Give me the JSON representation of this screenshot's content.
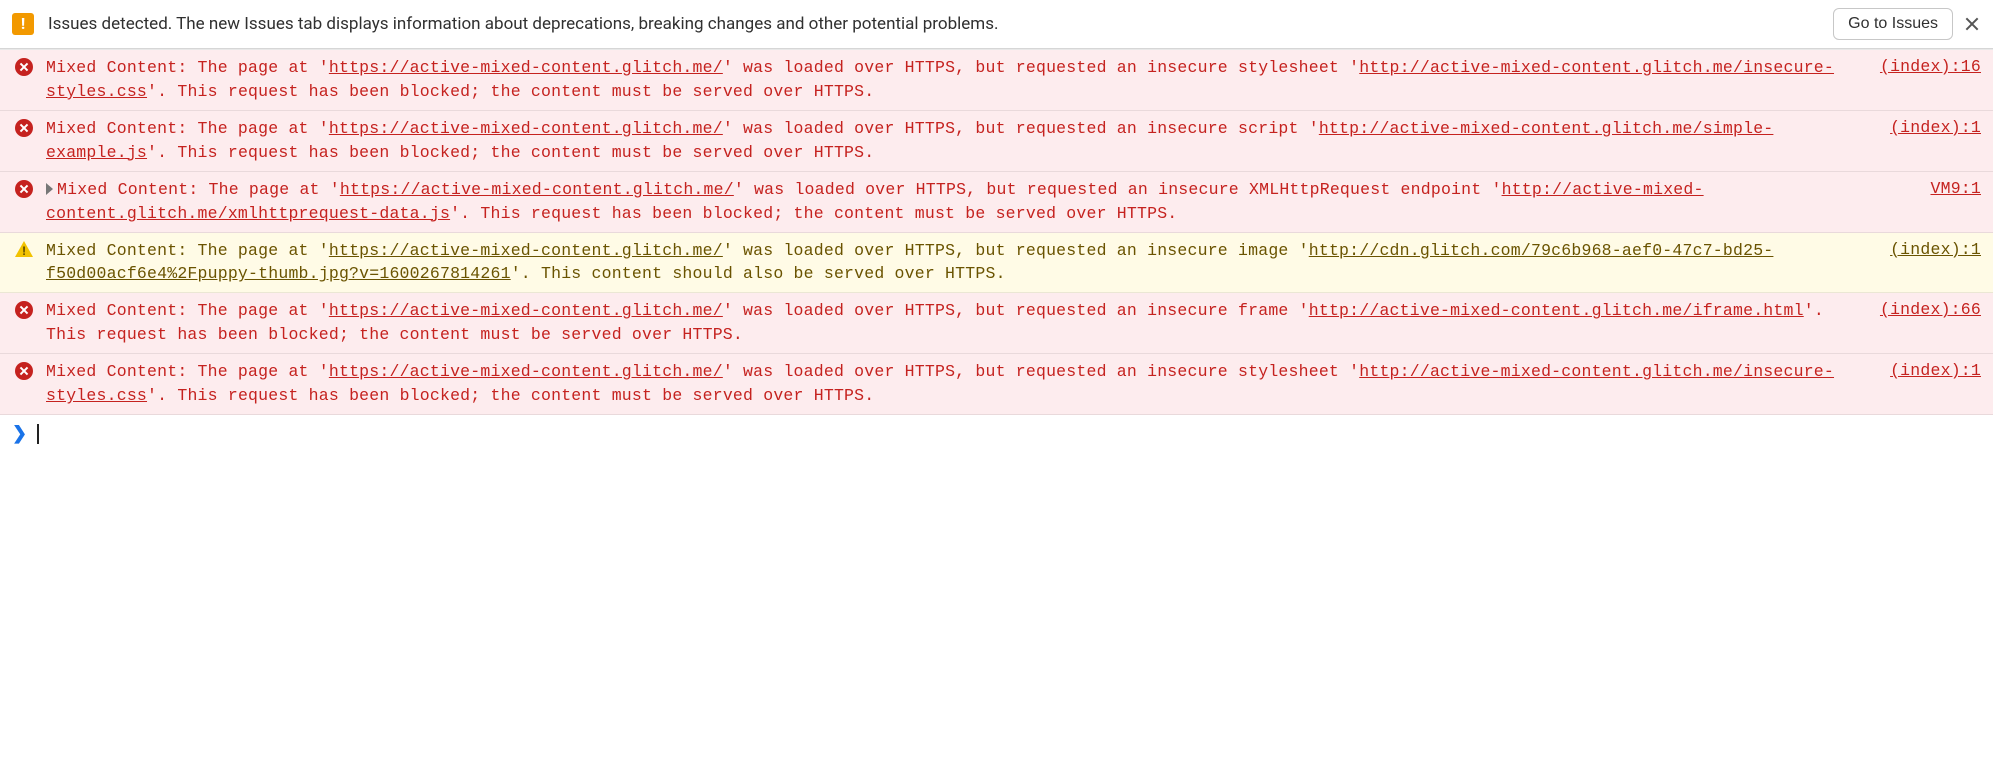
{
  "issues_bar": {
    "text": "Issues detected. The new Issues tab displays information about deprecations, breaking changes and other potential problems.",
    "button_label": "Go to Issues"
  },
  "messages": [
    {
      "level": "error",
      "expandable": false,
      "prefix": "Mixed Content: The page at '",
      "page_url": "https://active-mixed-content.glitch.me/",
      "mid1": "' was loaded over HTTPS, but requested an insecure stylesheet '",
      "resource_url": "http://active-mixed-content.glitch.me/insecure-styles.css",
      "suffix": "'. This request has been blocked; the content must be served over HTTPS.",
      "source": "(index):16"
    },
    {
      "level": "error",
      "expandable": false,
      "prefix": "Mixed Content: The page at '",
      "page_url": "https://active-mixed-content.glitch.me/",
      "mid1": "' was loaded over HTTPS, but requested an insecure script '",
      "resource_url": "http://active-mixed-content.glitch.me/simple-example.js",
      "suffix": "'. This request has been blocked; the content must be served over HTTPS.",
      "source": "(index):1"
    },
    {
      "level": "error",
      "expandable": true,
      "prefix": "Mixed Content: The page at '",
      "page_url": "https://active-mixed-content.glitch.me/",
      "mid1": "' was loaded over HTTPS, but requested an insecure XMLHttpRequest endpoint '",
      "resource_url": "http://active-mixed-content.glitch.me/xmlhttprequest-data.js",
      "suffix": "'. This request has been blocked; the content must be served over HTTPS.",
      "source": "VM9:1"
    },
    {
      "level": "warn",
      "expandable": false,
      "prefix": "Mixed Content: The page at '",
      "page_url": "https://active-mixed-content.glitch.me/",
      "mid1": "' was loaded over HTTPS, but requested an insecure image '",
      "resource_url": "http://cdn.glitch.com/79c6b968-aef0-47c7-bd25-f50d00acf6e4%2Fpuppy-thumb.jpg?v=1600267814261",
      "suffix": "'. This content should also be served over HTTPS.",
      "source": "(index):1"
    },
    {
      "level": "error",
      "expandable": false,
      "prefix": "Mixed Content: The page at '",
      "page_url": "https://active-mixed-content.glitch.me/",
      "mid1": "' was loaded over HTTPS, but requested an insecure frame '",
      "resource_url": "http://active-mixed-content.glitch.me/iframe.html",
      "suffix": "'. This request has been blocked; the content must be served over HTTPS.",
      "source": "(index):66"
    },
    {
      "level": "error",
      "expandable": false,
      "prefix": "Mixed Content: The page at '",
      "page_url": "https://active-mixed-content.glitch.me/",
      "mid1": "' was loaded over HTTPS, but requested an insecure stylesheet '",
      "resource_url": "http://active-mixed-content.glitch.me/insecure-styles.css",
      "suffix": "'. This request has been blocked; the content must be served over HTTPS.",
      "source": "(index):1"
    }
  ],
  "prompt": {
    "symbol": "❯"
  }
}
